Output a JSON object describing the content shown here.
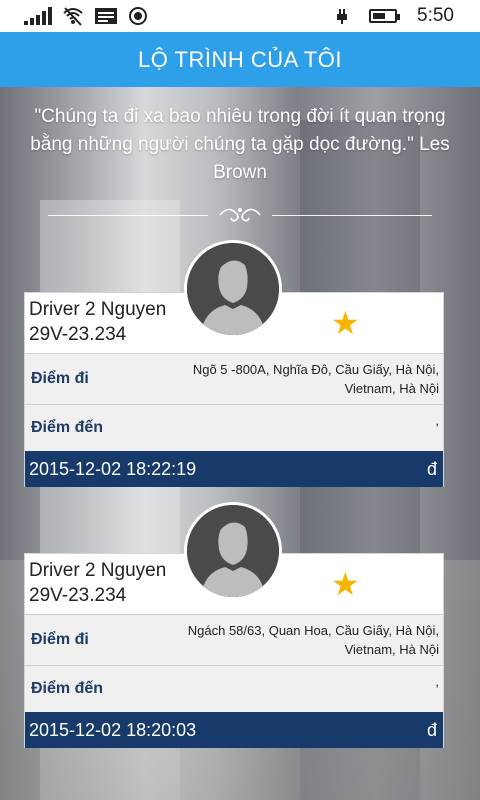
{
  "status_bar": {
    "time": "5:50",
    "icons": [
      "signal-icon",
      "wifi-icon",
      "message-icon",
      "target-icon",
      "battery-icon"
    ],
    "battery_level": 0.6
  },
  "header": {
    "title": "LỘ TRÌNH CỦA TÔI"
  },
  "quote": {
    "text": "\"Chúng ta đi xa bao nhiêu trong đời ít quan trọng bằng những người chúng ta gặp dọc đường.\" Les Brown"
  },
  "trips": [
    {
      "driver_name": "Driver 2 Nguyen",
      "plate": "29V-23.234",
      "from_label": "Điểm đi",
      "from_value": "Ngõ 5 -800A, Nghĩa Đô, Cầu Giấy, Hà Nội, Vietnam, Hà Nội",
      "to_label": "Điểm đến",
      "to_value": ",",
      "datetime": "2015-12-02 18:22:19",
      "currency": "đ"
    },
    {
      "driver_name": "Driver 2 Nguyen",
      "plate": "29V-23.234",
      "from_label": "Điểm đi",
      "from_value": "Ngách 58/63, Quan Hoa, Cầu Giấy, Hà Nội, Vietnam, Hà Nội",
      "to_label": "Điểm đến",
      "to_value": ",",
      "datetime": "2015-12-02 18:20:03",
      "currency": "đ"
    }
  ],
  "colors": {
    "header_bg": "#2ea0ea",
    "footer_bg": "#183a6a",
    "label_text": "#1f3b66",
    "star": "#f7b500"
  }
}
